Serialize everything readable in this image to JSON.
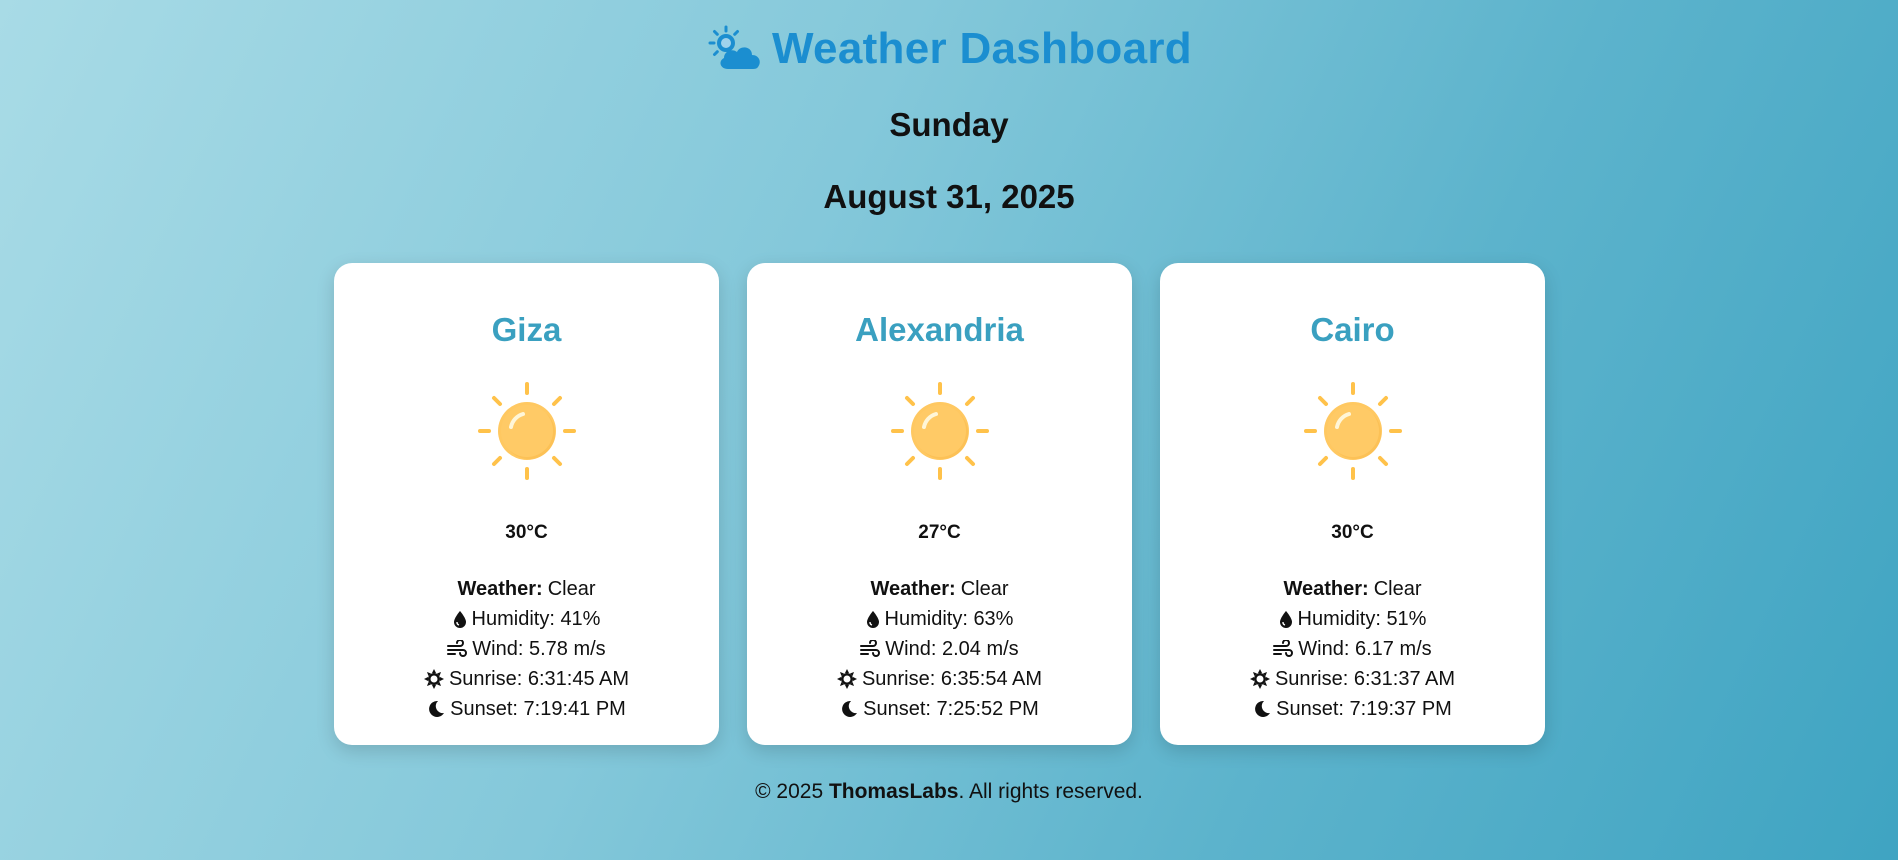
{
  "header": {
    "title": "Weather Dashboard",
    "icon": "sun-behind-cloud-icon",
    "title_color": "#1b8ed0"
  },
  "day": "Sunday",
  "date": "August 31, 2025",
  "colors": {
    "city": "#3aa0c0",
    "sun": "#ffc861",
    "sun_rays": "#ffc24a"
  },
  "cards": [
    {
      "city": "Giza",
      "icon": "sun-icon",
      "temp": "30°C",
      "weather_label": "Weather:",
      "weather": "Clear",
      "humidity": "Humidity: 41%",
      "wind": "Wind: 5.78 m/s",
      "sunrise": "Sunrise: 6:31:45 AM",
      "sunset": "Sunset: 7:19:41 PM"
    },
    {
      "city": "Alexandria",
      "icon": "sun-icon",
      "temp": "27°C",
      "weather_label": "Weather:",
      "weather": "Clear",
      "humidity": "Humidity: 63%",
      "wind": "Wind: 2.04 m/s",
      "sunrise": "Sunrise: 6:35:54 AM",
      "sunset": "Sunset: 7:25:52 PM"
    },
    {
      "city": "Cairo",
      "icon": "sun-icon",
      "temp": "30°C",
      "weather_label": "Weather:",
      "weather": "Clear",
      "humidity": "Humidity: 51%",
      "wind": "Wind: 6.17 m/s",
      "sunrise": "Sunrise: 6:31:37 AM",
      "sunset": "Sunset: 7:19:37 PM"
    }
  ],
  "footer": {
    "prefix": "© 2025 ",
    "brand": "ThomasLabs",
    "suffix": ". All rights reserved."
  }
}
